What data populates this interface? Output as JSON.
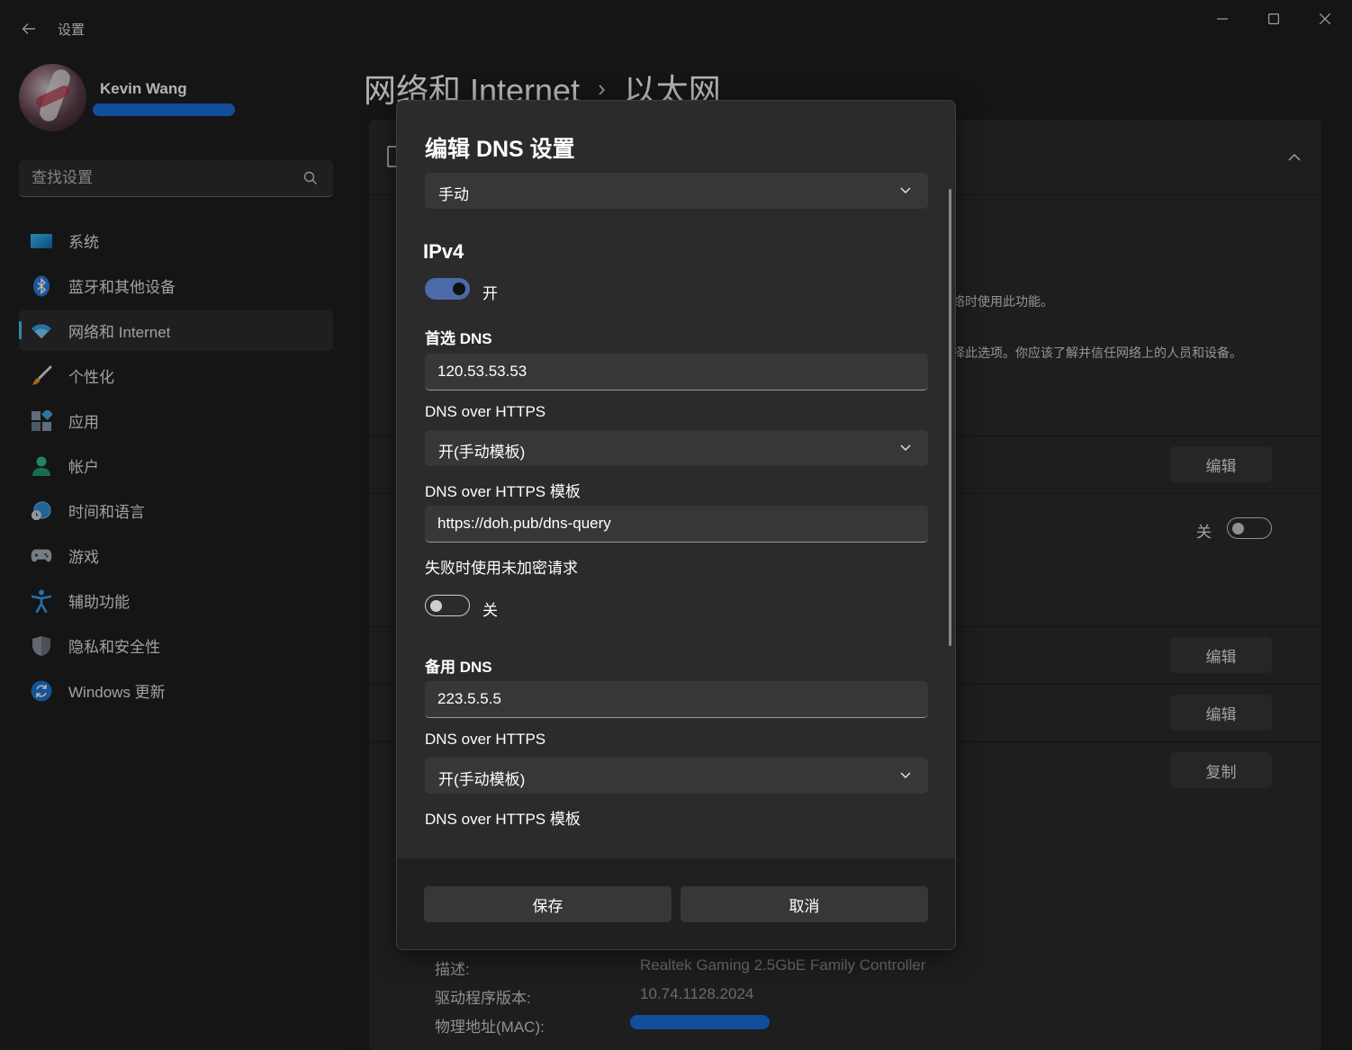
{
  "app": {
    "title": "设置",
    "back_icon": "arrow-left-icon"
  },
  "window_controls": {
    "minimize": "minimize-icon",
    "maximize": "maximize-icon",
    "close": "close-icon"
  },
  "user": {
    "name": "Kevin Wang"
  },
  "search": {
    "placeholder": "查找设置"
  },
  "nav": {
    "items": [
      {
        "label": "系统",
        "icon": "monitor-icon"
      },
      {
        "label": "蓝牙和其他设备",
        "icon": "bluetooth-icon"
      },
      {
        "label": "网络和 Internet",
        "icon": "wifi-icon",
        "active": true
      },
      {
        "label": "个性化",
        "icon": "paintbrush-icon"
      },
      {
        "label": "应用",
        "icon": "apps-icon"
      },
      {
        "label": "帐户",
        "icon": "person-icon"
      },
      {
        "label": "时间和语言",
        "icon": "globe-clock-icon"
      },
      {
        "label": "游戏",
        "icon": "gamepad-icon"
      },
      {
        "label": "辅助功能",
        "icon": "accessibility-icon"
      },
      {
        "label": "隐私和安全性",
        "icon": "shield-icon"
      },
      {
        "label": "Windows 更新",
        "icon": "refresh-icon"
      }
    ]
  },
  "breadcrumb": {
    "parent": "网络和 Internet",
    "separator": "›",
    "current": "以太网"
  },
  "background": {
    "text1": "络时使用此功能。",
    "text2": "择此选项。你应该了解并信任网络上的人员和设备。",
    "edit_label": "编辑",
    "copy_label": "复制",
    "metered_toggle_label": "关",
    "properties": [
      {
        "label": "描述:",
        "value": "Realtek Gaming 2.5GbE Family Controller"
      },
      {
        "label": "驱动程序版本:",
        "value": "10.74.1128.2024"
      },
      {
        "label": "物理地址(MAC):",
        "value": ""
      }
    ]
  },
  "dialog": {
    "title": "编辑 DNS 设置",
    "mode": "手动",
    "ipv4": {
      "heading": "IPv4",
      "toggle_label": "开",
      "preferred_label": "首选 DNS",
      "preferred_value": "120.53.53.53",
      "doh_label": "DNS over HTTPS",
      "doh_value": "开(手动模板)",
      "doh_template_label": "DNS over HTTPS 模板",
      "doh_template_value": "https://doh.pub/dns-query",
      "fallback_label": "失败时使用未加密请求",
      "fallback_toggle_label": "关",
      "alternate_label": "备用 DNS",
      "alternate_value": "223.5.5.5",
      "alt_doh_label": "DNS over HTTPS",
      "alt_doh_value": "开(手动模板)",
      "alt_doh_template_label": "DNS over HTTPS 模板"
    },
    "save_label": "保存",
    "cancel_label": "取消"
  }
}
